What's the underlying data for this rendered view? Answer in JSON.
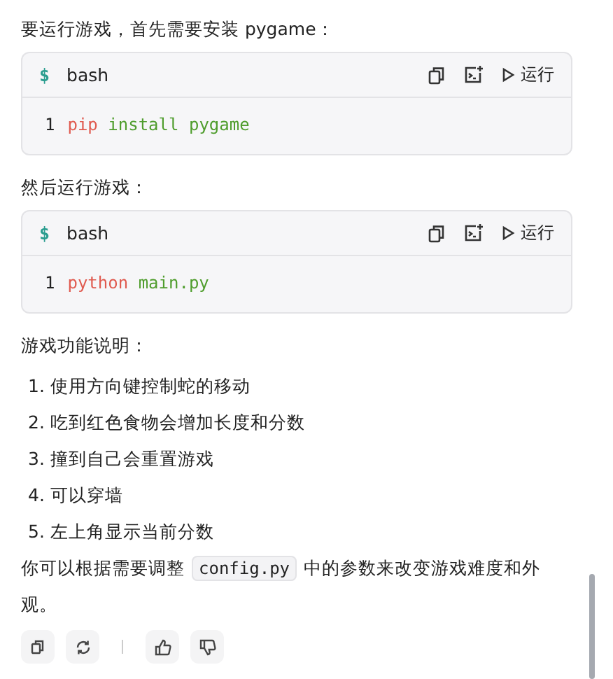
{
  "intro": "要运行游戏，首先需要安装 pygame：",
  "code_blocks": [
    {
      "prompt": "$",
      "language": "bash",
      "run_label": "运行",
      "lines": [
        {
          "number": "1",
          "tokens": [
            {
              "kind": "command",
              "text": "pip"
            },
            {
              "kind": "arg",
              "text": "install"
            },
            {
              "kind": "arg",
              "text": "pygame"
            }
          ]
        }
      ]
    },
    {
      "prompt": "$",
      "language": "bash",
      "run_label": "运行",
      "lines": [
        {
          "number": "1",
          "tokens": [
            {
              "kind": "command",
              "text": "python"
            },
            {
              "kind": "arg",
              "text": "main.py"
            }
          ]
        }
      ]
    }
  ],
  "between": "然后运行游戏：",
  "features_title": "游戏功能说明：",
  "features": [
    {
      "number": "1.",
      "text": "使用方向键控制蛇的移动"
    },
    {
      "number": "2.",
      "text": "吃到红色食物会增加长度和分数"
    },
    {
      "number": "3.",
      "text": "撞到自己会重置游戏"
    },
    {
      "number": "4.",
      "text": "可以穿墙"
    },
    {
      "number": "5.",
      "text": "左上角显示当前分数"
    }
  ],
  "closing": {
    "before": "你可以根据需要调整",
    "code": "config.py",
    "after": "中的参数来改变游戏难度和外观。"
  }
}
